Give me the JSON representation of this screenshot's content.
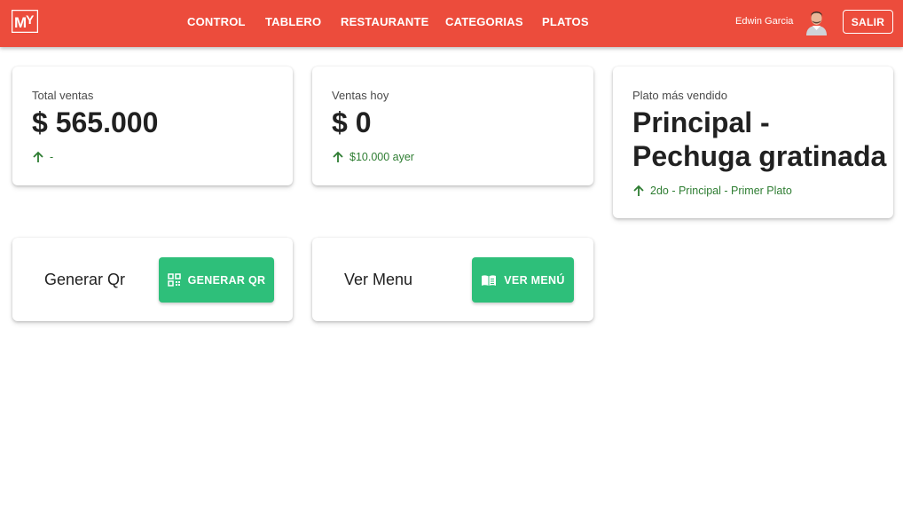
{
  "colors": {
    "appbar": "#ec4c3c",
    "success": "#2ebf7a",
    "trend": "#2e7d32"
  },
  "header": {
    "logo_text": "MY",
    "nav": [
      {
        "label": "CONTROL"
      },
      {
        "label": "TABLERO"
      },
      {
        "label": "RESTAURANTE"
      },
      {
        "label": "CATEGORIAS"
      },
      {
        "label": "PLATOS"
      }
    ],
    "user_name": "Edwin Garcia",
    "logout_label": "SALIR"
  },
  "stats": {
    "total": {
      "label": "Total ventas",
      "value": "$ 565.000",
      "trend": "-"
    },
    "today": {
      "label": "Ventas hoy",
      "value": "$ 0",
      "trend": "$10.000 ayer"
    },
    "top_dish": {
      "label": "Plato más vendido",
      "value": "Principal - Pechuga gratinada",
      "trend": "2do - Principal - Primer Plato"
    }
  },
  "actions": {
    "qr": {
      "label": "Generar Qr",
      "button": "GENERAR QR",
      "icon": "qr-code-icon"
    },
    "menu": {
      "label": "Ver Menu",
      "button": "VER MENÚ",
      "icon": "book-icon"
    }
  }
}
